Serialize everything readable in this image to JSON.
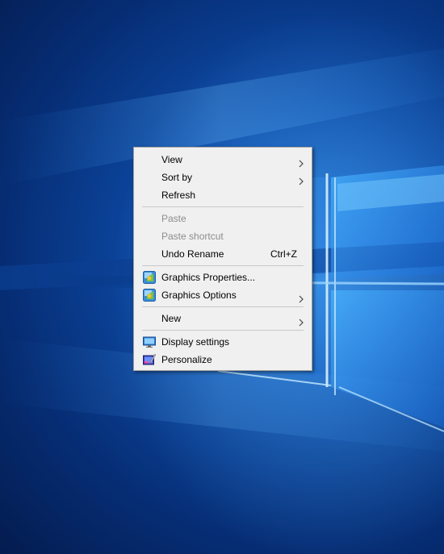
{
  "context_menu": {
    "groups": [
      [
        {
          "label": "View",
          "has_submenu": true,
          "enabled": true
        },
        {
          "label": "Sort by",
          "has_submenu": true,
          "enabled": true
        },
        {
          "label": "Refresh",
          "has_submenu": false,
          "enabled": true
        }
      ],
      [
        {
          "label": "Paste",
          "has_submenu": false,
          "enabled": false
        },
        {
          "label": "Paste shortcut",
          "has_submenu": false,
          "enabled": false
        },
        {
          "label": "Undo Rename",
          "shortcut": "Ctrl+Z",
          "has_submenu": false,
          "enabled": true
        }
      ],
      [
        {
          "label": "Graphics Properties...",
          "icon": "intel-graphics-icon",
          "has_submenu": false,
          "enabled": true
        },
        {
          "label": "Graphics Options",
          "icon": "intel-graphics-icon",
          "has_submenu": true,
          "enabled": true
        }
      ],
      [
        {
          "label": "New",
          "has_submenu": true,
          "enabled": true
        }
      ],
      [
        {
          "label": "Display settings",
          "icon": "display-settings-icon",
          "has_submenu": false,
          "enabled": true
        },
        {
          "label": "Personalize",
          "icon": "personalize-icon",
          "has_submenu": false,
          "enabled": true
        }
      ]
    ]
  },
  "colors": {
    "menu_background": "#f0f0f0",
    "disabled_text": "#8d8d8d",
    "wallpaper_blue": "#0d4aa5"
  }
}
